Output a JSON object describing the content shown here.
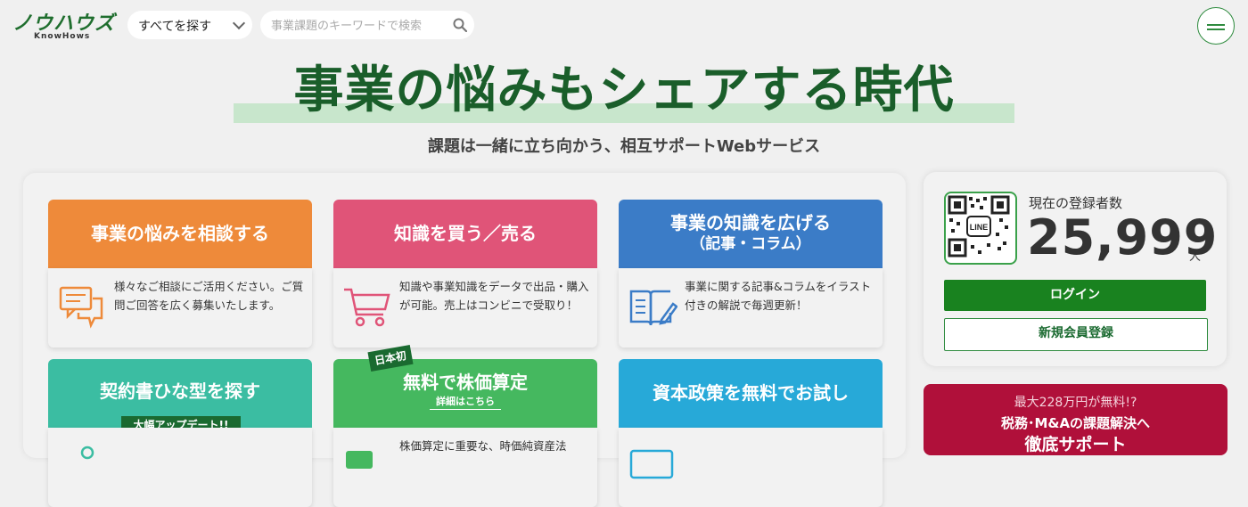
{
  "header": {
    "logo_text": "ノウハウズ",
    "logo_sub": "KnowHows",
    "category_select": "すべてを探す",
    "search_placeholder": "事業課題のキーワードで検索"
  },
  "hero": {
    "title": "事業の悩みもシェアする時代",
    "subtitle": "課題は一緒に立ち向かう、相互サポートWebサービス"
  },
  "services": [
    {
      "title": "事業の悩みを相談する",
      "desc": "様々なご相談にご活用ください。ご質問ご回答を広く募集いたします。",
      "color": "#ee8a3a",
      "icon": "chat-icon"
    },
    {
      "title": "知識を買う／売る",
      "desc": "知識や事業知識をデータで出品・購入が可能。売上はコンビニで受取り！",
      "color": "#e05478",
      "icon": "cart-icon"
    },
    {
      "title": "事業の知識を広げる",
      "title2": "（記事・コラム）",
      "desc": "事業に関する記事&コラムをイラスト付きの解説で毎週更新！",
      "color": "#3b7cc7",
      "icon": "book-edit-icon"
    },
    {
      "title": "契約書ひな型を探す",
      "badge": "大幅アップデート!!",
      "color": "#3bbda2",
      "desc": "",
      "icon": "document-icon"
    },
    {
      "title": "無料で株価算定",
      "badge_top": "日本初",
      "link": "詳細はこちら",
      "color": "#45b85f",
      "desc": "株価算定に重要な、時価純資産法",
      "icon": "calculator-icon"
    },
    {
      "title": "資本政策を無料でお試し",
      "color": "#27a9d8",
      "desc": "",
      "icon": "monitor-icon"
    }
  ],
  "registration": {
    "label": "現在の登録者数",
    "count": "25,999",
    "unit": "人",
    "qr_label": "LINE",
    "login": "ログイン",
    "signup": "新規会員登録"
  },
  "promo": {
    "line1": "最大228万円が無料!?",
    "line2": "税務･M&Aの課題解決へ",
    "line3": "徹底サポート"
  },
  "colors": {
    "brand": "#1a5e2a",
    "accent": "#19821f",
    "promo": "#b0103a"
  }
}
